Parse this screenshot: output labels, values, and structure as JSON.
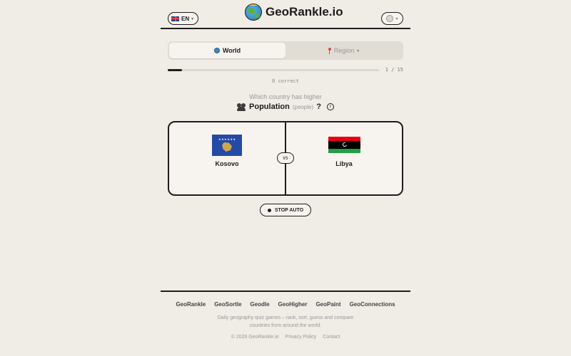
{
  "header": {
    "language": "EN",
    "logo_text": "GeoRankle.io"
  },
  "tabs": [
    {
      "label": "World",
      "active": true
    },
    {
      "label": "Region",
      "active": false
    }
  ],
  "progress": {
    "text": "1 / 15",
    "fraction": 0.0667,
    "correct_text": "0 correct"
  },
  "question": {
    "prompt": "Which country has higher",
    "metric": "Population",
    "unit": "(people)",
    "suffix": "?",
    "info": "i"
  },
  "compare": {
    "left": {
      "name": "Kosovo"
    },
    "right": {
      "name": "Libya"
    },
    "vs": "VS"
  },
  "stop_auto": "STOP AUTO",
  "footer": {
    "links": [
      "GeoRankle",
      "GeoSortle",
      "Geodle",
      "GeoHigher",
      "GeoPaint",
      "GeoConnections"
    ],
    "tagline": "Daily geography quiz games – rank, sort, guess and compare countries from around the world.",
    "copyright": "© 2026 GeoRankle.io",
    "privacy": "Privacy Policy",
    "contact": "Contact"
  },
  "colors": {
    "background": "#f0ece6",
    "ink": "#1d1d1d",
    "card": "#f7f4ef"
  }
}
